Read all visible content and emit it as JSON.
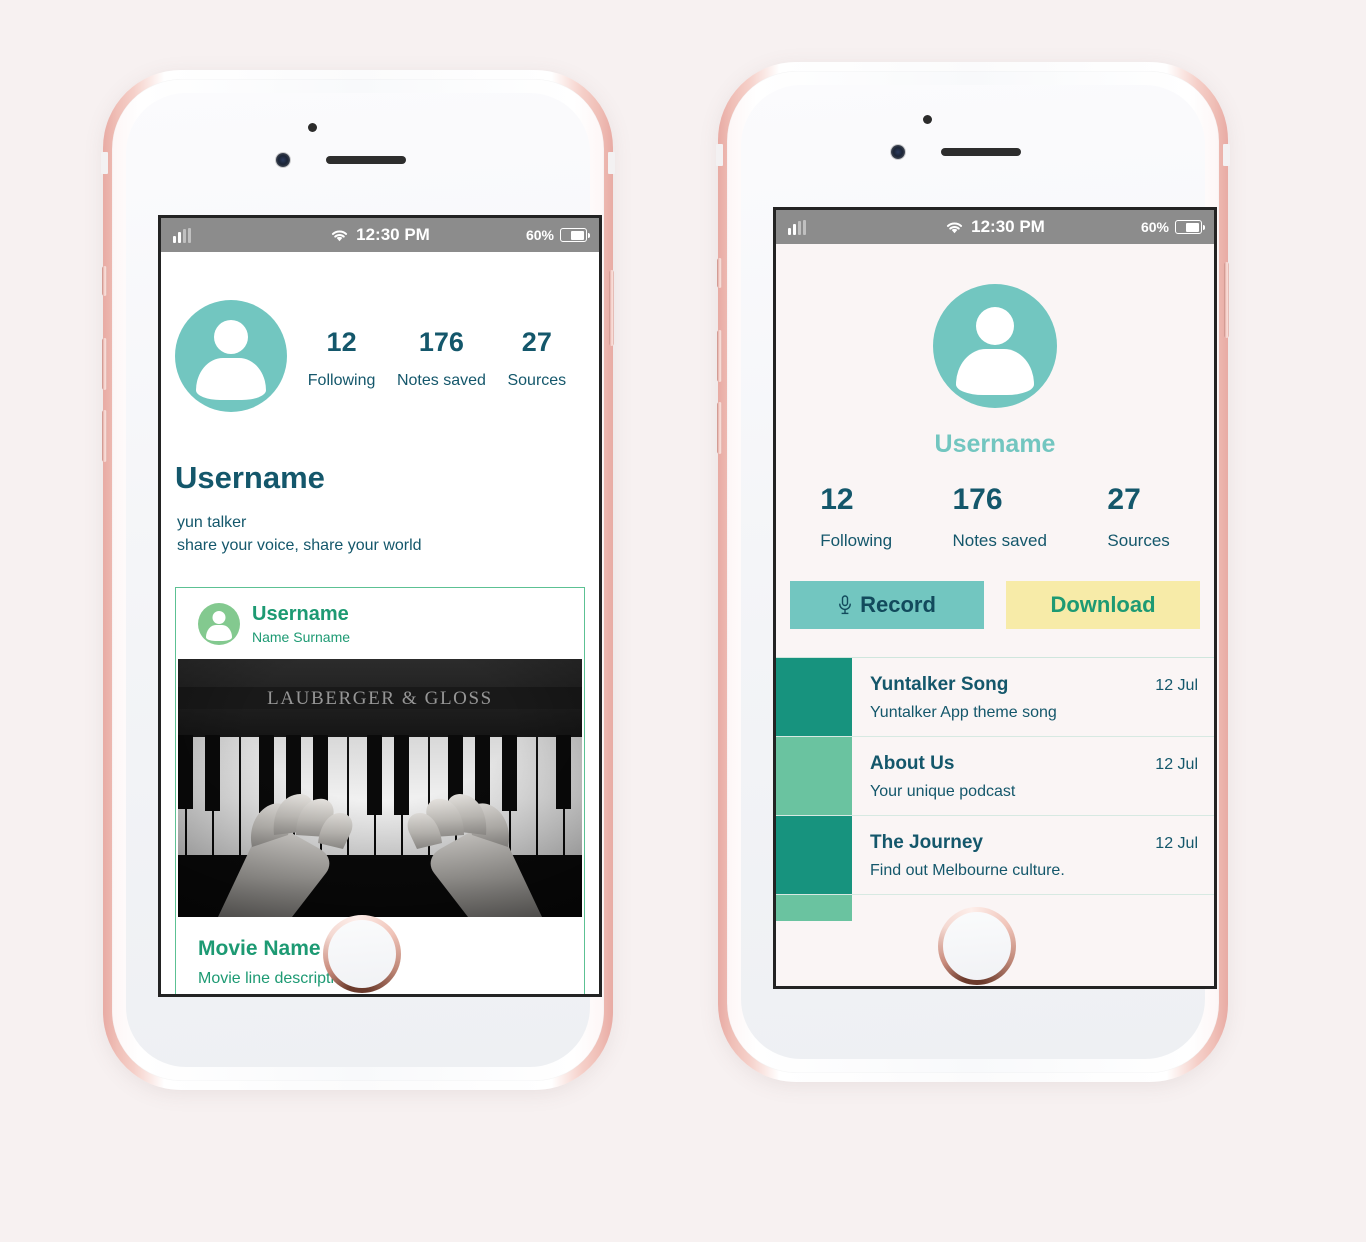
{
  "status_bar": {
    "signal_icon": "signal-bars-icon",
    "wifi_icon": "wifi-icon",
    "time": "12:30 PM",
    "battery_percent": "60%",
    "battery_icon": "battery-icon"
  },
  "profile_screen": {
    "avatar_icon": "user-avatar-icon",
    "stats": [
      {
        "value": "12",
        "label": "Following"
      },
      {
        "value": "176",
        "label": "Notes saved"
      },
      {
        "value": "27",
        "label": "Sources"
      }
    ],
    "display_name": "Username",
    "bio_line_1": "yun talker",
    "bio_line_2": "share your voice, share your world",
    "post_card": {
      "author_avatar_icon": "user-avatar-small-icon",
      "author_username": "Username",
      "author_fullname": "Name Surname",
      "image_alt": "piano-keys-photo",
      "image_brand_text": "LAUBERGER & GLOSS",
      "movie_title": "Movie Name",
      "movie_description": "Movie line description"
    }
  },
  "dashboard_screen": {
    "avatar_icon": "user-avatar-icon",
    "username": "Username",
    "stats": [
      {
        "value": "12",
        "label": "Following"
      },
      {
        "value": "176",
        "label": "Notes saved"
      },
      {
        "value": "27",
        "label": "Sources"
      }
    ],
    "actions": {
      "record_label": "Record",
      "record_icon": "microphone-icon",
      "download_label": "Download"
    },
    "recordings": [
      {
        "title": "Yuntalker Song",
        "description": "Yuntalker App theme song",
        "date": "12 Jul",
        "swatch": "#17937e"
      },
      {
        "title": "About Us",
        "description": "Your unique podcast",
        "date": "12 Jul",
        "swatch": "#6ac3a0"
      },
      {
        "title": "The Journey",
        "description": " Find out Melbourne culture.",
        "date": "12 Jul",
        "swatch": "#17937e"
      }
    ],
    "partial_row_swatch": "#6ac3a0"
  },
  "colors": {
    "page_background": "#f7f1f1",
    "teal_primary": "#72c6c0",
    "teal_dark_text": "#14576b",
    "green_accent": "#1d9a73",
    "green_border": "#5cc193",
    "yellow_button": "#f7eba8",
    "status_bar_gray": "#8c8c8c",
    "phone_bezel_rose": "#f0c0b8"
  }
}
